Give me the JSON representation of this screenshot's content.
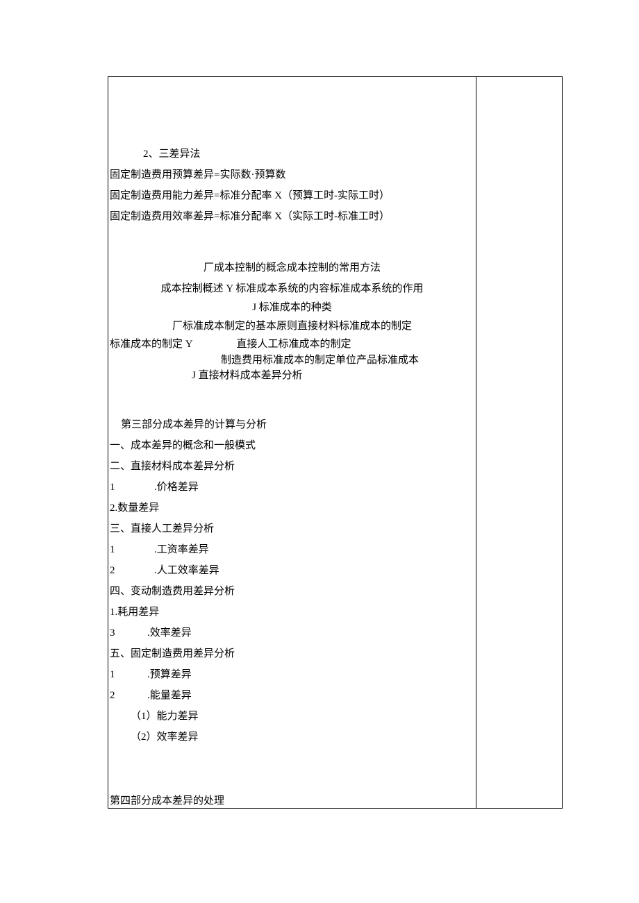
{
  "top": {
    "l1": "2、三差异法",
    "l2": "固定制造费用预算差异=实际数·预算数",
    "l3": "固定制造费用能力差异=标准分配率 X（预算工时-实际工时）",
    "l4": "固定制造费用效率差异=标准分配率 X（实际工时-标准工时）"
  },
  "mid": {
    "l1": "厂成本控制的概念成本控制的常用方法",
    "l2": "成本控制概述 Y 标准成本系统的内容标准成本系统的作用",
    "l3": "J 标准成本的种类",
    "l4": "厂标准成本制定的基本原则直接材料标准成本的制定",
    "l5a": "标准成本的制定 Y",
    "l5b": "直接人工标准成本的制定",
    "l6": "制造费用标准成本的制定单位产品标准成本",
    "l7": "J 直接材料成本差异分析"
  },
  "sec3": {
    "title": "第三部分成本差异的计算与分析",
    "i1": "一、成本差异的概念和一般模式",
    "i2": "二、直接材料成本差异分析",
    "i2_1n": "1",
    "i2_1t": ".价格差异",
    "i2_2": "2.数量差异",
    "i3": "三、直接人工差异分析",
    "i3_1n": "1",
    "i3_1t": ".工资率差异",
    "i3_2n": "2",
    "i3_2t": ".人工效率差异",
    "i4": "四、变动制造费用差异分析",
    "i4_1": "1.耗用差异",
    "i4_2n": "3",
    "i4_2t": ".效率差异",
    "i5": "五、固定制造费用差异分析",
    "i5_1n": "1",
    "i5_1t": ".预算差异",
    "i5_2n": "2",
    "i5_2t": ".能量差异",
    "i5_2a": "（1）能力差异",
    "i5_2b": "（2）效率差异"
  },
  "sec4": {
    "title": "第四部分成本差异的处理"
  }
}
